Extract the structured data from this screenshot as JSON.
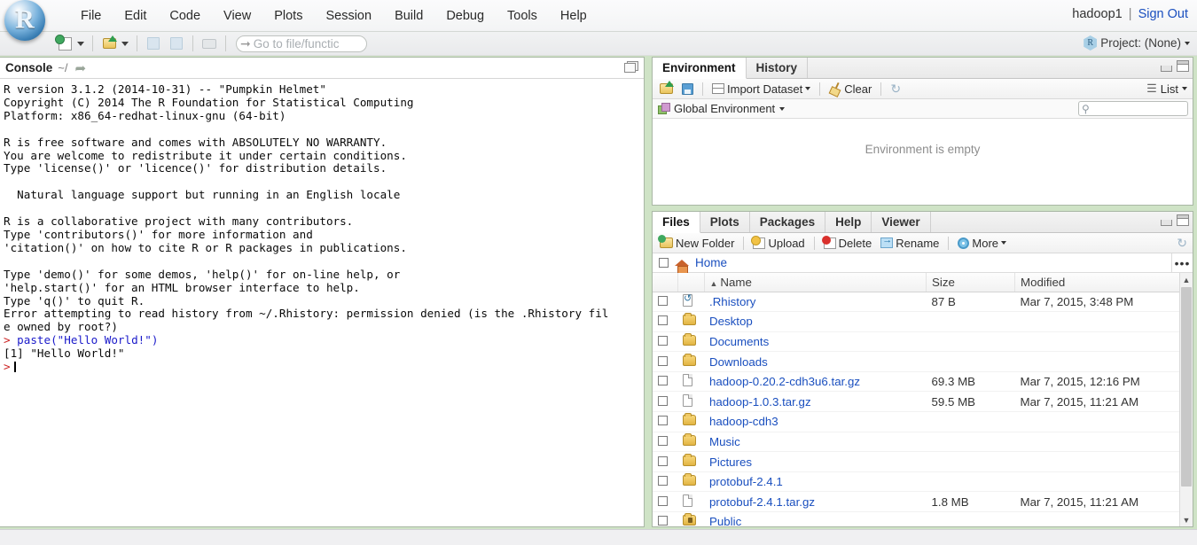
{
  "app": {
    "logo_label": "R",
    "user": "hadoop1",
    "separator": "|",
    "sign_out": "Sign Out",
    "project_label": "Project: (None)"
  },
  "menu": {
    "items": [
      {
        "label": "File"
      },
      {
        "label": "Edit"
      },
      {
        "label": "Code"
      },
      {
        "label": "View"
      },
      {
        "label": "Plots"
      },
      {
        "label": "Session"
      },
      {
        "label": "Build"
      },
      {
        "label": "Debug"
      },
      {
        "label": "Tools"
      },
      {
        "label": "Help"
      }
    ]
  },
  "toolbar": {
    "new_file_icon": "new-file-icon",
    "open_file_icon": "open-folder-icon",
    "save_icon": "save-icon",
    "save_all_icon": "save-all-icon",
    "print_icon": "print-icon",
    "goto_placeholder": "Go to file/functic"
  },
  "console": {
    "tab_label": "Console",
    "path": "~/",
    "output_header": "R version 3.1.2 (2014-10-31) -- \"Pumpkin Helmet\"\nCopyright (C) 2014 The R Foundation for Statistical Computing\nPlatform: x86_64-redhat-linux-gnu (64-bit)\n\nR is free software and comes with ABSOLUTELY NO WARRANTY.\nYou are welcome to redistribute it under certain conditions.\nType 'license()' or 'licence()' for distribution details.\n\n  Natural language support but running in an English locale\n\nR is a collaborative project with many contributors.\nType 'contributors()' for more information and\n'citation()' on how to cite R or R packages in publications.\n\nType 'demo()' for some demos, 'help()' for on-line help, or\n'help.start()' for an HTML browser interface to help.\nType 'q()' to quit R.\n",
    "error_text": "Error attempting to read history from ~/.Rhistory: permission denied (is the .Rhistory fil\ne owned by root?)",
    "prompt": ">",
    "command": " paste(\"Hello World!\")",
    "result": "[1] \"Hello World!\"",
    "prompt2": ">"
  },
  "environment": {
    "tabs": [
      {
        "label": "Environment",
        "active": true
      },
      {
        "label": "History",
        "active": false
      }
    ],
    "toolbar": {
      "open_icon": "open-folder-icon",
      "save_icon": "save-icon",
      "import_dataset": "Import Dataset",
      "clear": "Clear",
      "refresh_icon": "refresh-icon",
      "list_label": "List"
    },
    "scope_label": "Global Environment",
    "search_placeholder": "",
    "empty_message": "Environment is empty"
  },
  "files": {
    "tabs": [
      {
        "label": "Files",
        "active": true
      },
      {
        "label": "Plots",
        "active": false
      },
      {
        "label": "Packages",
        "active": false
      },
      {
        "label": "Help",
        "active": false
      },
      {
        "label": "Viewer",
        "active": false
      }
    ],
    "toolbar": {
      "new_folder": "New Folder",
      "upload": "Upload",
      "delete": "Delete",
      "rename": "Rename",
      "more": "More",
      "refresh_icon": "refresh-icon"
    },
    "path_label": "Home",
    "more_dots": "•••",
    "columns": [
      "",
      "",
      "Name",
      "Size",
      "Modified"
    ],
    "sort_column": "Name",
    "rows": [
      {
        "icon": "history-file-icon",
        "name": ".Rhistory",
        "size": "87 B",
        "modified": "Mar 7, 2015, 3:48 PM"
      },
      {
        "icon": "folder-icon",
        "name": "Desktop",
        "size": "",
        "modified": ""
      },
      {
        "icon": "folder-icon",
        "name": "Documents",
        "size": "",
        "modified": ""
      },
      {
        "icon": "folder-icon",
        "name": "Downloads",
        "size": "",
        "modified": ""
      },
      {
        "icon": "file-icon",
        "name": "hadoop-0.20.2-cdh3u6.tar.gz",
        "size": "69.3 MB",
        "modified": "Mar 7, 2015, 12:16 PM"
      },
      {
        "icon": "file-icon",
        "name": "hadoop-1.0.3.tar.gz",
        "size": "59.5 MB",
        "modified": "Mar 7, 2015, 11:21 AM"
      },
      {
        "icon": "folder-icon",
        "name": "hadoop-cdh3",
        "size": "",
        "modified": ""
      },
      {
        "icon": "folder-icon",
        "name": "Music",
        "size": "",
        "modified": ""
      },
      {
        "icon": "folder-icon",
        "name": "Pictures",
        "size": "",
        "modified": ""
      },
      {
        "icon": "folder-icon",
        "name": "protobuf-2.4.1",
        "size": "",
        "modified": ""
      },
      {
        "icon": "file-icon",
        "name": "protobuf-2.4.1.tar.gz",
        "size": "1.8 MB",
        "modified": "Mar 7, 2015, 11:21 AM"
      },
      {
        "icon": "folder-locked-icon",
        "name": "Public",
        "size": "",
        "modified": ""
      }
    ]
  },
  "colors": {
    "chrome_green": "#cfe3c6",
    "link_blue": "#1a4fbf",
    "error_red": "#cc2222",
    "command_blue": "#1a1aca"
  }
}
